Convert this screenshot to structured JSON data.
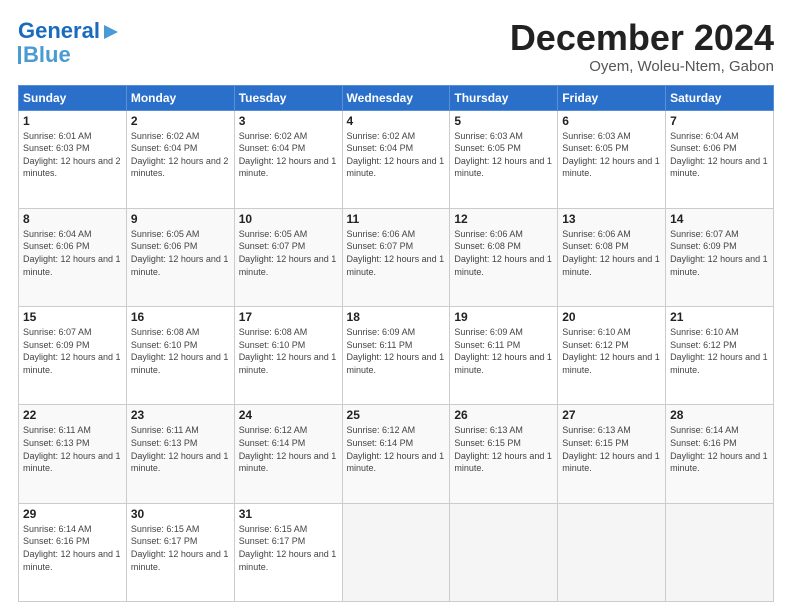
{
  "logo": {
    "line1": "General",
    "line2": "Blue"
  },
  "header": {
    "month": "December 2024",
    "location": "Oyem, Woleu-Ntem, Gabon"
  },
  "weekdays": [
    "Sunday",
    "Monday",
    "Tuesday",
    "Wednesday",
    "Thursday",
    "Friday",
    "Saturday"
  ],
  "weeks": [
    [
      {
        "day": "1",
        "sunrise": "6:01 AM",
        "sunset": "6:03 PM",
        "daylight": "12 hours and 2 minutes."
      },
      {
        "day": "2",
        "sunrise": "6:02 AM",
        "sunset": "6:04 PM",
        "daylight": "12 hours and 2 minutes."
      },
      {
        "day": "3",
        "sunrise": "6:02 AM",
        "sunset": "6:04 PM",
        "daylight": "12 hours and 1 minute."
      },
      {
        "day": "4",
        "sunrise": "6:02 AM",
        "sunset": "6:04 PM",
        "daylight": "12 hours and 1 minute."
      },
      {
        "day": "5",
        "sunrise": "6:03 AM",
        "sunset": "6:05 PM",
        "daylight": "12 hours and 1 minute."
      },
      {
        "day": "6",
        "sunrise": "6:03 AM",
        "sunset": "6:05 PM",
        "daylight": "12 hours and 1 minute."
      },
      {
        "day": "7",
        "sunrise": "6:04 AM",
        "sunset": "6:06 PM",
        "daylight": "12 hours and 1 minute."
      }
    ],
    [
      {
        "day": "8",
        "sunrise": "6:04 AM",
        "sunset": "6:06 PM",
        "daylight": "12 hours and 1 minute."
      },
      {
        "day": "9",
        "sunrise": "6:05 AM",
        "sunset": "6:06 PM",
        "daylight": "12 hours and 1 minute."
      },
      {
        "day": "10",
        "sunrise": "6:05 AM",
        "sunset": "6:07 PM",
        "daylight": "12 hours and 1 minute."
      },
      {
        "day": "11",
        "sunrise": "6:06 AM",
        "sunset": "6:07 PM",
        "daylight": "12 hours and 1 minute."
      },
      {
        "day": "12",
        "sunrise": "6:06 AM",
        "sunset": "6:08 PM",
        "daylight": "12 hours and 1 minute."
      },
      {
        "day": "13",
        "sunrise": "6:06 AM",
        "sunset": "6:08 PM",
        "daylight": "12 hours and 1 minute."
      },
      {
        "day": "14",
        "sunrise": "6:07 AM",
        "sunset": "6:09 PM",
        "daylight": "12 hours and 1 minute."
      }
    ],
    [
      {
        "day": "15",
        "sunrise": "6:07 AM",
        "sunset": "6:09 PM",
        "daylight": "12 hours and 1 minute."
      },
      {
        "day": "16",
        "sunrise": "6:08 AM",
        "sunset": "6:10 PM",
        "daylight": "12 hours and 1 minute."
      },
      {
        "day": "17",
        "sunrise": "6:08 AM",
        "sunset": "6:10 PM",
        "daylight": "12 hours and 1 minute."
      },
      {
        "day": "18",
        "sunrise": "6:09 AM",
        "sunset": "6:11 PM",
        "daylight": "12 hours and 1 minute."
      },
      {
        "day": "19",
        "sunrise": "6:09 AM",
        "sunset": "6:11 PM",
        "daylight": "12 hours and 1 minute."
      },
      {
        "day": "20",
        "sunrise": "6:10 AM",
        "sunset": "6:12 PM",
        "daylight": "12 hours and 1 minute."
      },
      {
        "day": "21",
        "sunrise": "6:10 AM",
        "sunset": "6:12 PM",
        "daylight": "12 hours and 1 minute."
      }
    ],
    [
      {
        "day": "22",
        "sunrise": "6:11 AM",
        "sunset": "6:13 PM",
        "daylight": "12 hours and 1 minute."
      },
      {
        "day": "23",
        "sunrise": "6:11 AM",
        "sunset": "6:13 PM",
        "daylight": "12 hours and 1 minute."
      },
      {
        "day": "24",
        "sunrise": "6:12 AM",
        "sunset": "6:14 PM",
        "daylight": "12 hours and 1 minute."
      },
      {
        "day": "25",
        "sunrise": "6:12 AM",
        "sunset": "6:14 PM",
        "daylight": "12 hours and 1 minute."
      },
      {
        "day": "26",
        "sunrise": "6:13 AM",
        "sunset": "6:15 PM",
        "daylight": "12 hours and 1 minute."
      },
      {
        "day": "27",
        "sunrise": "6:13 AM",
        "sunset": "6:15 PM",
        "daylight": "12 hours and 1 minute."
      },
      {
        "day": "28",
        "sunrise": "6:14 AM",
        "sunset": "6:16 PM",
        "daylight": "12 hours and 1 minute."
      }
    ],
    [
      {
        "day": "29",
        "sunrise": "6:14 AM",
        "sunset": "6:16 PM",
        "daylight": "12 hours and 1 minute."
      },
      {
        "day": "30",
        "sunrise": "6:15 AM",
        "sunset": "6:17 PM",
        "daylight": "12 hours and 1 minute."
      },
      {
        "day": "31",
        "sunrise": "6:15 AM",
        "sunset": "6:17 PM",
        "daylight": "12 hours and 1 minute."
      },
      null,
      null,
      null,
      null
    ]
  ]
}
